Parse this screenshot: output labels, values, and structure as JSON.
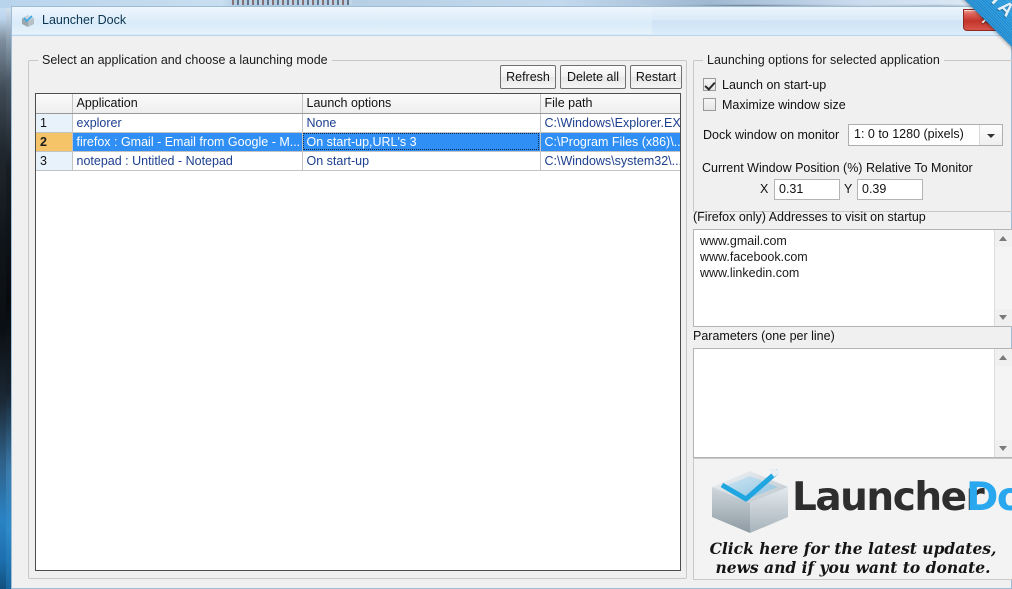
{
  "window": {
    "title": "Launcher Dock",
    "icon": "launcher-dock-icon",
    "close_label": "✕",
    "ribbon_label": "BETA"
  },
  "left_panel": {
    "legend": "Select an application and choose a launching mode",
    "buttons": [
      {
        "id": "refresh",
        "label": "Refresh"
      },
      {
        "id": "delete-all",
        "label": "Delete all"
      },
      {
        "id": "restart",
        "label": "Restart"
      }
    ],
    "table": {
      "headers": [
        "",
        "Application",
        "Launch options",
        "File path"
      ],
      "rows": [
        {
          "num": "1",
          "application": "explorer",
          "launch_options": "None",
          "file_path": "C:\\Windows\\Explorer.EXE",
          "selected": false
        },
        {
          "num": "2",
          "application": "firefox : Gmail - Email from Google - M...",
          "launch_options": "On start-up,URL's 3",
          "file_path": "C:\\Program Files (x86)\\...",
          "selected": true
        },
        {
          "num": "3",
          "application": "notepad : Untitled - Notepad",
          "launch_options": "On start-up",
          "file_path": "C:\\Windows\\system32\\...",
          "selected": false
        }
      ]
    }
  },
  "right_panel": {
    "legend": "Launching options for selected application",
    "checkboxes": [
      {
        "id": "launch-on-startup",
        "label": "Launch on start-up",
        "checked": true
      },
      {
        "id": "maximize-window-size",
        "label": "Maximize window size",
        "checked": false
      }
    ],
    "monitor": {
      "label": "Dock window on monitor",
      "selected": "1: 0 to 1280 (pixels)",
      "options": [
        "1: 0 to 1280 (pixels)"
      ]
    },
    "position": {
      "label": "Current Window Position (%) Relative To Monitor",
      "x_label": "X",
      "x_value": "0.31",
      "y_label": "Y",
      "y_value": "0.39"
    },
    "addresses": {
      "label": "(Firefox only) Addresses to visit on startup",
      "value": "www.gmail.com\nwww.facebook.com\nwww.linkedin.com"
    },
    "parameters": {
      "label": "Parameters  (one per line)",
      "value": ""
    }
  },
  "banner": {
    "logo_icon": "launcher-dock-cube-logo",
    "word_first": "Launcher",
    "word_second": "Dock",
    "tagline": "Click here for the latest updates,\nnews and if you want to donate."
  },
  "colors": {
    "selection_blue": "#2f8ff5",
    "rownum_orange": "#f5c469",
    "ribbon_blue": "#2aa0e4",
    "brand_cyan": "#2aa8ef",
    "close_red": "#c1342a",
    "cell_text_blue": "#1c3f8f"
  }
}
